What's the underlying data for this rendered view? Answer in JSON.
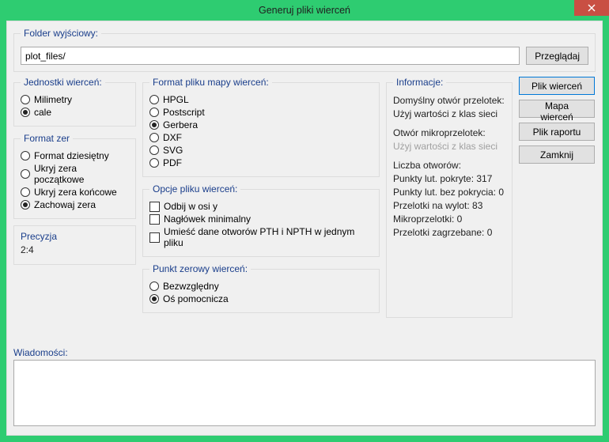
{
  "window": {
    "title": "Generuj pliki wierceń"
  },
  "folder": {
    "legend": "Folder wyjściowy:",
    "value": "plot_files/",
    "browse": "Przeglądaj"
  },
  "units": {
    "legend": "Jednostki wierceń:",
    "mm": "Milimetry",
    "in": "cale"
  },
  "zeros": {
    "legend": "Format zer",
    "decimal": "Format dziesiętny",
    "suppress_leading": "Ukryj zera początkowe",
    "suppress_trailing": "Ukryj zera końcowe",
    "keep": "Zachowaj zera"
  },
  "precision": {
    "legend": "Precyzja",
    "value": "2:4"
  },
  "mapfmt": {
    "legend": "Format pliku mapy wierceń:",
    "hpgl": "HPGL",
    "ps": "Postscript",
    "gerber": "Gerbera",
    "dxf": "DXF",
    "svg": "SVG",
    "pdf": "PDF"
  },
  "opts": {
    "legend": "Opcje pliku wierceń:",
    "mirror": "Odbij w osi y",
    "minhdr": "Nagłówek minimalny",
    "merge": "Umieść dane otworów PTH i NPTH w jednym pliku"
  },
  "origin": {
    "legend": "Punkt zerowy wierceń:",
    "abs": "Bezwzględny",
    "aux": "Oś pomocnicza"
  },
  "info": {
    "legend": "Informacje:",
    "via_default": "Domyślny otwór przelotek:",
    "via_default_val": "Użyj wartości z klas sieci",
    "uvia": "Otwór mikroprzelotek:",
    "uvia_val": "Użyj wartości z klas sieci",
    "count": "Liczba otworów:",
    "pads_plated": "Punkty lut. pokryte: 317",
    "pads_unplated": "Punkty lut. bez pokrycia: 0",
    "through_vias": "Przelotki na wylot: 83",
    "micro_vias": "Mikroprzelotki: 0",
    "buried_vias": "Przelotki zagrzebane: 0"
  },
  "actions": {
    "drill": "Plik wierceń",
    "map": "Mapa wierceń",
    "report": "Plik raportu",
    "close": "Zamknij"
  },
  "messages": {
    "legend": "Wiadomości:"
  }
}
